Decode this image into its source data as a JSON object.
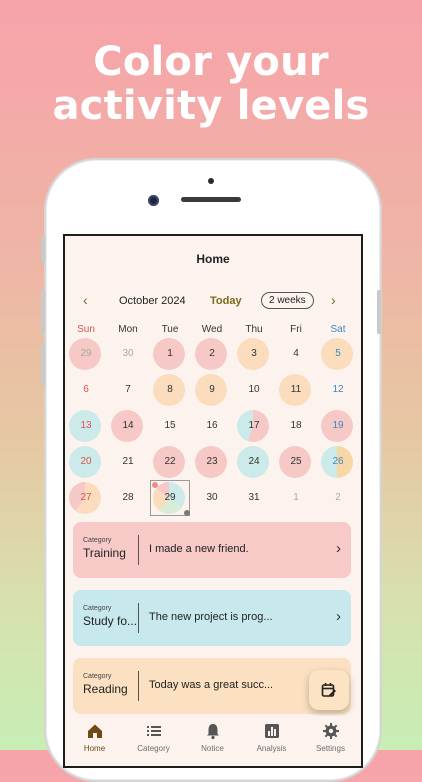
{
  "headline": {
    "line1": "Color your",
    "line2": "activity levels"
  },
  "screen": {
    "title": "Home"
  },
  "calendar": {
    "month": "October 2024",
    "today_label": "Today",
    "view_label": "2 weeks",
    "weekdays": [
      "Sun",
      "Mon",
      "Tue",
      "Wed",
      "Thu",
      "Fri",
      "Sat"
    ],
    "days": [
      "29",
      "30",
      "1",
      "2",
      "3",
      "4",
      "5",
      "6",
      "7",
      "8",
      "9",
      "10",
      "11",
      "12",
      "13",
      "14",
      "15",
      "16",
      "17",
      "18",
      "19",
      "20",
      "21",
      "22",
      "23",
      "24",
      "25",
      "26",
      "27",
      "28",
      "29",
      "30",
      "31",
      "1",
      "2"
    ],
    "colors": {
      "sun": "#d9534f",
      "sat": "#3b88c4",
      "dim": "#a8a8a8",
      "pink": "#f6c9c6",
      "peach": "#fbdcbc",
      "teal": "#cdeaea",
      "mint": "#d8ecd8",
      "yellow": "#f7d7a6"
    }
  },
  "cards": [
    {
      "category_label": "Category",
      "category": "Training",
      "text": "I made a new friend.",
      "color": "#f7c9c7"
    },
    {
      "category_label": "Category",
      "category": "Study fo...",
      "text": "The new project is prog...",
      "color": "#c7e9ee"
    },
    {
      "category_label": "Category",
      "category": "Reading",
      "text": "Today was a great succ...",
      "color": "#fbe0c1"
    }
  ],
  "nav": {
    "items": [
      {
        "label": "Home",
        "icon": "home-icon"
      },
      {
        "label": "Category",
        "icon": "list-icon"
      },
      {
        "label": "Notice",
        "icon": "bell-icon"
      },
      {
        "label": "Analysis",
        "icon": "chart-icon"
      },
      {
        "label": "Settings",
        "icon": "gear-icon"
      }
    ]
  }
}
